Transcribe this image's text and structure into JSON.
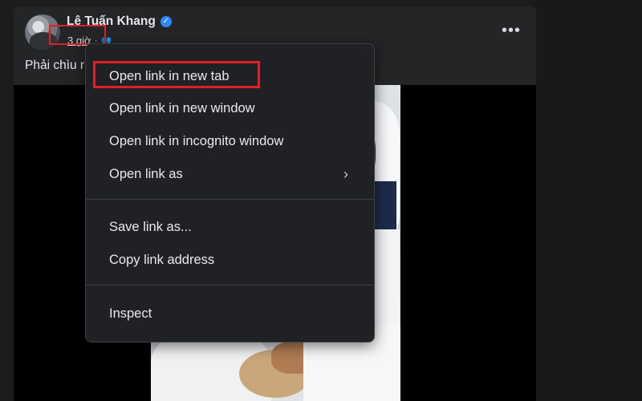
{
  "post": {
    "author": "Lê Tuấn Khang",
    "time": "3 giờ",
    "separator": "·",
    "text": "Phải chìu r",
    "more_label": "•••"
  },
  "context_menu": {
    "items": [
      {
        "label": "Open link in new tab",
        "highlighted": true
      },
      {
        "label": "Open link in new window"
      },
      {
        "label": "Open link in incognito window"
      },
      {
        "label": "Open link as",
        "submenu": true
      },
      {
        "label": "Save link as..."
      },
      {
        "label": "Copy link address"
      },
      {
        "label": "Inspect"
      }
    ]
  },
  "icons": {
    "verified": "verified-badge-icon",
    "audience": "friends-audience-icon",
    "submenu": "chevron-right-icon",
    "more": "more-options-icon"
  },
  "colors": {
    "annotation": "#e01f26",
    "verified": "#2d88ff",
    "menu_bg": "#202124"
  }
}
